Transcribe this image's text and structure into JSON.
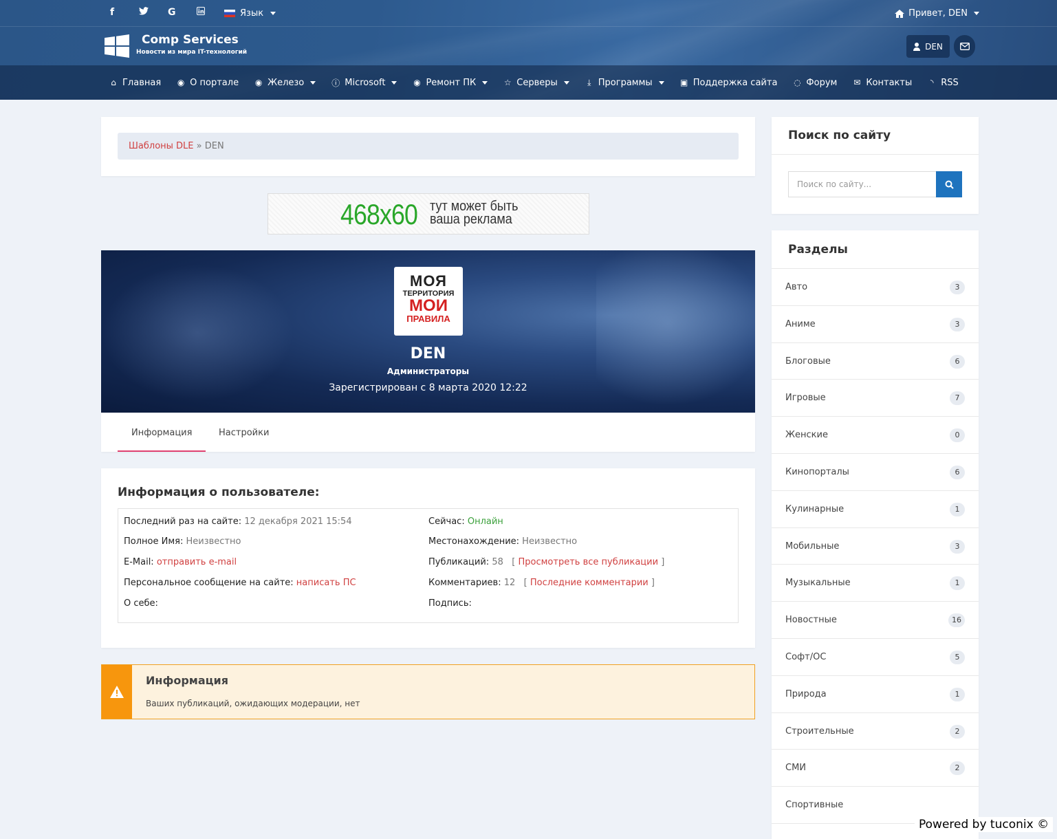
{
  "header": {
    "social_icons": [
      "facebook-icon",
      "twitter-icon",
      "google-icon",
      "linkedin-icon"
    ],
    "language_label": "Язык",
    "greeting": "Привет, DEN",
    "logo_title": "Comp Services",
    "logo_subtitle": "Новости из мира IT-технологий",
    "user_button": "DEN"
  },
  "nav": {
    "items": [
      {
        "label": "Главная",
        "icon": "home-icon"
      },
      {
        "label": "О портале",
        "icon": "globe-icon"
      },
      {
        "label": "Железо",
        "icon": "globe-icon",
        "dropdown": true
      },
      {
        "label": "Microsoft",
        "icon": "info-icon",
        "dropdown": true
      },
      {
        "label": "Ремонт ПК",
        "icon": "globe-icon",
        "dropdown": true
      },
      {
        "label": "Серверы",
        "icon": "star-icon",
        "dropdown": true
      },
      {
        "label": "Программы",
        "icon": "download-icon",
        "dropdown": true
      },
      {
        "label": "Поддержка сайта",
        "icon": "money-icon"
      },
      {
        "label": "Форум",
        "icon": "comments-icon"
      },
      {
        "label": "Контакты",
        "icon": "envelope-icon"
      },
      {
        "label": "RSS",
        "icon": "rss-icon"
      }
    ]
  },
  "breadcrumb": {
    "link": "Шаблоны DLE",
    "separator": " » ",
    "current": "DEN"
  },
  "ad": {
    "size": "468x60",
    "line1": "тут может быть",
    "line2": "ваша реклама"
  },
  "profile": {
    "avatar_lines": [
      "МОЯ",
      "ТЕРРИТОРИЯ",
      "МОИ",
      "ПРАВИЛА"
    ],
    "name": "DEN",
    "group": "Администраторы",
    "registered": "Зарегистрирован с 8 марта 2020 12:22"
  },
  "tabs": [
    "Информация",
    "Настройки"
  ],
  "info": {
    "title": "Информация о пользователе:",
    "last_visit_label": "Последний раз на сайте:",
    "last_visit_value": "12 декабря 2021 15:54",
    "fullname_label": "Полное Имя:",
    "fullname_value": "Неизвестно",
    "email_label": "E-Mail:",
    "email_link": "отправить e-mail",
    "pm_label": "Персональное сообщение на сайте:",
    "pm_link": "написать ПС",
    "about_label": "О себе:",
    "now_label": "Сейчас:",
    "now_value": "Онлайн",
    "location_label": "Местонахождение:",
    "location_value": "Неизвестно",
    "posts_label": "Публикаций:",
    "posts_value": "58",
    "posts_link": "Просмотреть все публикации",
    "comments_label": "Комментариев:",
    "comments_value": "12",
    "comments_link": "Последние комментарии",
    "signature_label": "Подпись:"
  },
  "alert": {
    "title": "Информация",
    "text": "Ваших публикаций, ожидающих модерации, нет"
  },
  "sidebar": {
    "search_title": "Поиск по сайту",
    "search_placeholder": "Поиск по сайту...",
    "categories_title": "Разделы",
    "categories": [
      {
        "name": "Авто",
        "count": "3"
      },
      {
        "name": "Аниме",
        "count": "3"
      },
      {
        "name": "Блоговые",
        "count": "6"
      },
      {
        "name": "Игровые",
        "count": "7"
      },
      {
        "name": "Женские",
        "count": "0"
      },
      {
        "name": "Кинопорталы",
        "count": "6"
      },
      {
        "name": "Кулинарные",
        "count": "1"
      },
      {
        "name": "Мобильные",
        "count": "3"
      },
      {
        "name": "Музыкальные",
        "count": "1"
      },
      {
        "name": "Новостные",
        "count": "16"
      },
      {
        "name": "Софт/ОС",
        "count": "5"
      },
      {
        "name": "Природа",
        "count": "1"
      },
      {
        "name": "Строительные",
        "count": "2"
      },
      {
        "name": "СМИ",
        "count": "2"
      },
      {
        "name": "Спортивные",
        "count": ""
      }
    ]
  },
  "footer": {
    "powered": "Powered by tuconix ©"
  }
}
